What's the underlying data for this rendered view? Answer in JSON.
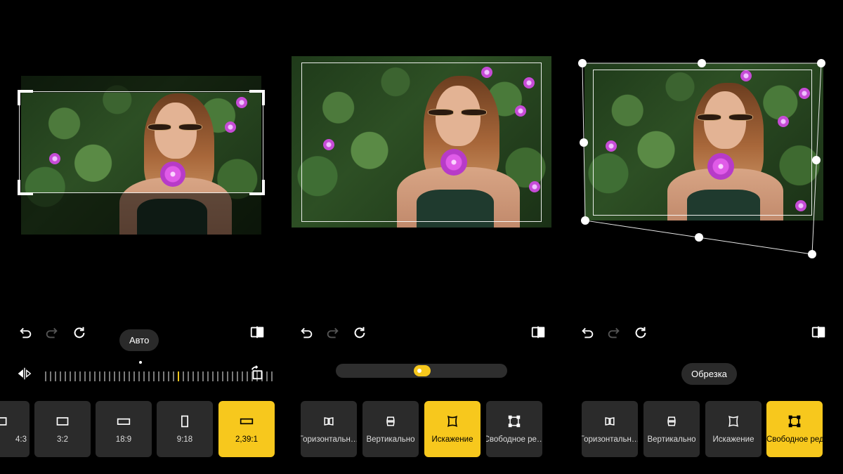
{
  "panels": [
    {
      "id": "crop",
      "tooltip": "Авто",
      "tiles": [
        {
          "label": "4:3",
          "icon": "aspect-4-3-icon",
          "active": false
        },
        {
          "label": "3:2",
          "icon": "aspect-3-2-icon",
          "active": false
        },
        {
          "label": "18:9",
          "icon": "aspect-18-9-icon",
          "active": false
        },
        {
          "label": "9:18",
          "icon": "aspect-9-18-icon",
          "active": false
        },
        {
          "label": "2,39:1",
          "icon": "aspect-239-1-icon",
          "active": true
        }
      ]
    },
    {
      "id": "distortion",
      "slider_value": 0.5,
      "tiles": [
        {
          "label": "Горизонтальн…",
          "icon": "horizontal-perspective-icon",
          "active": false
        },
        {
          "label": "Вертикально",
          "icon": "vertical-perspective-icon",
          "active": false
        },
        {
          "label": "Искажение",
          "icon": "distortion-icon",
          "active": true
        },
        {
          "label": "Свободное ре…",
          "icon": "free-transform-icon",
          "active": false
        }
      ]
    },
    {
      "id": "free-transform",
      "tooltip": "Обрезка",
      "tiles": [
        {
          "label": "Горизонтальн…",
          "icon": "horizontal-perspective-icon",
          "active": false
        },
        {
          "label": "Вертикально",
          "icon": "vertical-perspective-icon",
          "active": false
        },
        {
          "label": "Искажение",
          "icon": "distortion-icon",
          "active": false
        },
        {
          "label": "Свободное редактирование",
          "icon": "free-transform-icon",
          "active": true
        }
      ]
    }
  ],
  "icons": {
    "undo": "undo-icon",
    "redo": "redo-icon",
    "reset": "reset-icon",
    "compare": "compare-icon",
    "flip": "flip-horizontal-icon",
    "rotate": "rotate-icon"
  },
  "colors": {
    "accent": "#f7c81d",
    "background": "#000000",
    "tile": "#2b2b2b"
  }
}
